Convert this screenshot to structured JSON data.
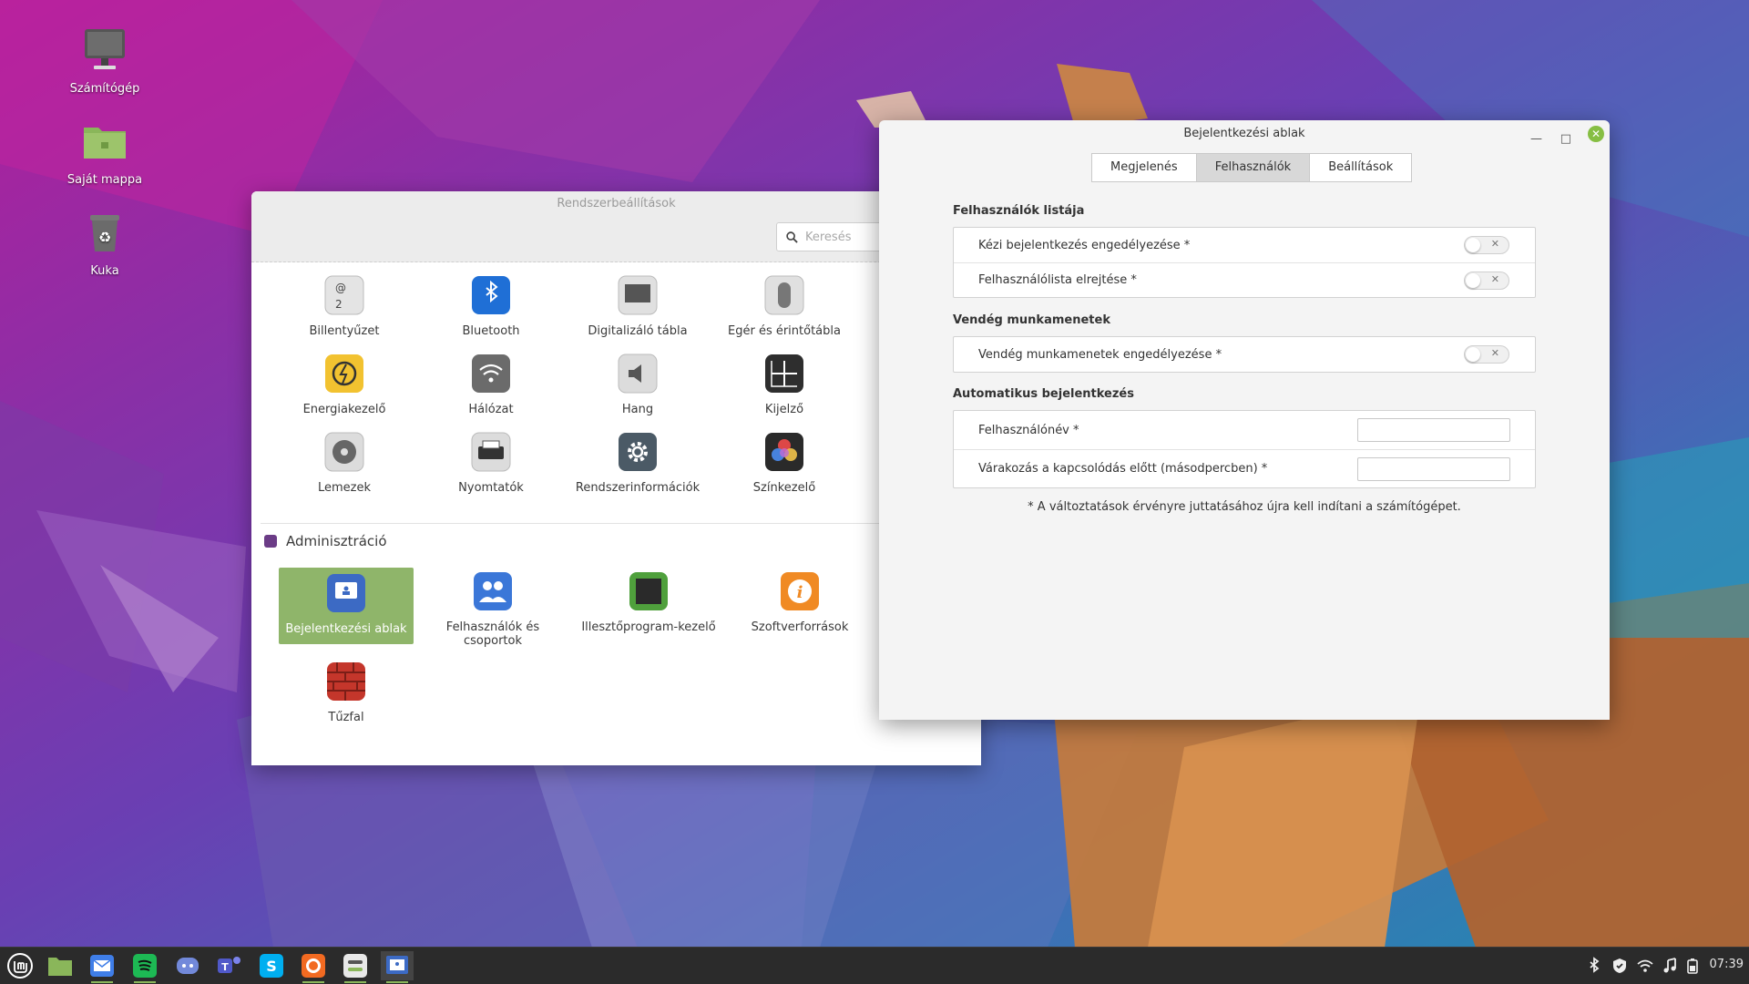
{
  "desktop": {
    "icons": [
      {
        "label": "Számítógép"
      },
      {
        "label": "Saját mappa"
      },
      {
        "label": "Kuka"
      }
    ]
  },
  "settings_window": {
    "title": "Rendszerbeállítások",
    "search_placeholder": "Keresés",
    "items": [
      {
        "label": "Billentyűzet",
        "icon": "keyboard-icon"
      },
      {
        "label": "Bluetooth",
        "icon": "bluetooth-icon"
      },
      {
        "label": "Digitalizáló tábla",
        "icon": "tablet-icon"
      },
      {
        "label": "Egér és érintőtábla",
        "icon": "mouse-icon"
      },
      {
        "label": "Energiakezelő",
        "icon": "power-icon"
      },
      {
        "label": "Hálózat",
        "icon": "wifi-icon"
      },
      {
        "label": "Hang",
        "icon": "speaker-icon"
      },
      {
        "label": "Kijelző",
        "icon": "display-icon"
      },
      {
        "label": "Lemezek",
        "icon": "disk-icon"
      },
      {
        "label": "Nyomtatók",
        "icon": "printer-icon"
      },
      {
        "label": "Rendszerinformációk",
        "icon": "gear-icon"
      },
      {
        "label": "Színkezelő",
        "icon": "color-icon"
      }
    ],
    "admin_section": "Adminisztráció",
    "admin_items": [
      {
        "label": "Bejelentkezési ablak",
        "icon": "login-window-icon"
      },
      {
        "label": "Felhasználók és csoportok",
        "icon": "users-icon"
      },
      {
        "label": "Illesztőprogram-kezelő",
        "icon": "chip-icon"
      },
      {
        "label": "Szoftverforrások",
        "icon": "info-icon"
      },
      {
        "label": "Tűzfal",
        "icon": "firewall-icon"
      }
    ]
  },
  "login_window": {
    "title": "Bejelentkezési ablak",
    "tabs": [
      "Megjelenés",
      "Felhasználók",
      "Beállítások"
    ],
    "active_tab": "Felhasználók",
    "sections": {
      "users_list": {
        "heading": "Felhasználók listája",
        "rows": [
          "Kézi bejelentkezés engedélyezése *",
          "Felhasználólista elrejtése *"
        ]
      },
      "guest": {
        "heading": "Vendég munkamenetek",
        "rows": [
          "Vendég munkamenetek engedélyezése *"
        ]
      },
      "autologin": {
        "heading": "Automatikus bejelentkezés",
        "rows": [
          "Felhasználónév *",
          "Várakozás a kapcsolódás előtt (másodpercben) *"
        ]
      }
    },
    "note": "* A változtatások érvényre juttatásához újra kell indítani a számítógépet."
  },
  "taskbar": {
    "clock": "07:39"
  }
}
